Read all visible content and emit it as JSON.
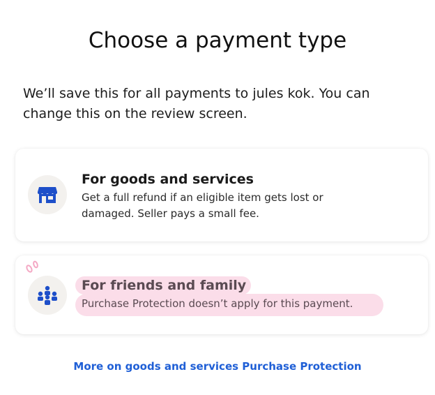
{
  "header": {
    "title": "Choose a payment type",
    "description": "We’ll save this for all payments to jules kok. You can change this on the review screen."
  },
  "options": [
    {
      "icon": "storefront-icon",
      "title": "For goods and services",
      "body": "Get a full refund if an eligible item gets lost or damaged. Seller pays a small fee."
    },
    {
      "icon": "people-group-icon",
      "title": "For friends and family",
      "body": "Purchase Protection doesn’t apply for this payment."
    }
  ],
  "footer": {
    "link_label": "More on goods and services Purchase Protection"
  },
  "colors": {
    "brand_blue": "#1f5fd6",
    "icon_blue": "#1e4fc9",
    "highlight_pink": "#fbdde9",
    "icon_circle_bg": "#f3f1ee"
  }
}
